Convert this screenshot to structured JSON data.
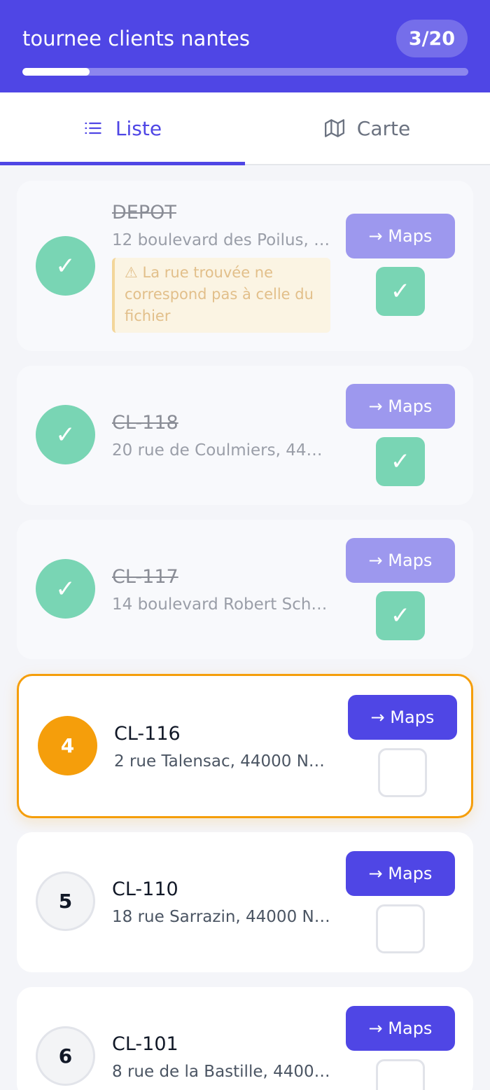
{
  "header": {
    "title": "tournee clients nantes",
    "progress_label": "3/20",
    "progress_fraction": 0.15
  },
  "tabs": [
    {
      "label": "Liste",
      "icon": "list-icon",
      "active": true
    },
    {
      "label": "Carte",
      "icon": "map-icon",
      "active": false
    }
  ],
  "stops": [
    {
      "marker": "✓",
      "name": "DEPOT",
      "address": "12 boulevard des Poilus, 4...",
      "warning": "⚠ La rue trouvée ne correspond pas à celle du fichier",
      "maps_label": "→ Maps",
      "checked": true,
      "check_glyph": "✓"
    },
    {
      "marker": "✓",
      "name": "CL-118",
      "address": "20 rue de Coulmiers, 4400...",
      "maps_label": "→ Maps",
      "checked": true,
      "check_glyph": "✓"
    },
    {
      "marker": "✓",
      "name": "CL-117",
      "address": "14 boulevard Robert Schu...",
      "maps_label": "→ Maps",
      "checked": true,
      "check_glyph": "✓"
    },
    {
      "marker": "4",
      "name": "CL-116",
      "address": "2 rue Talensac, 44000 Na...",
      "maps_label": "→ Maps",
      "checked": false,
      "current": true
    },
    {
      "marker": "5",
      "name": "CL-110",
      "address": "18 rue Sarrazin, 44000 Na...",
      "maps_label": "→ Maps",
      "checked": false
    },
    {
      "marker": "6",
      "name": "CL-101",
      "address": "8 rue de la Bastille, 44000 ...",
      "maps_label": "→ Maps",
      "checked": false
    }
  ]
}
